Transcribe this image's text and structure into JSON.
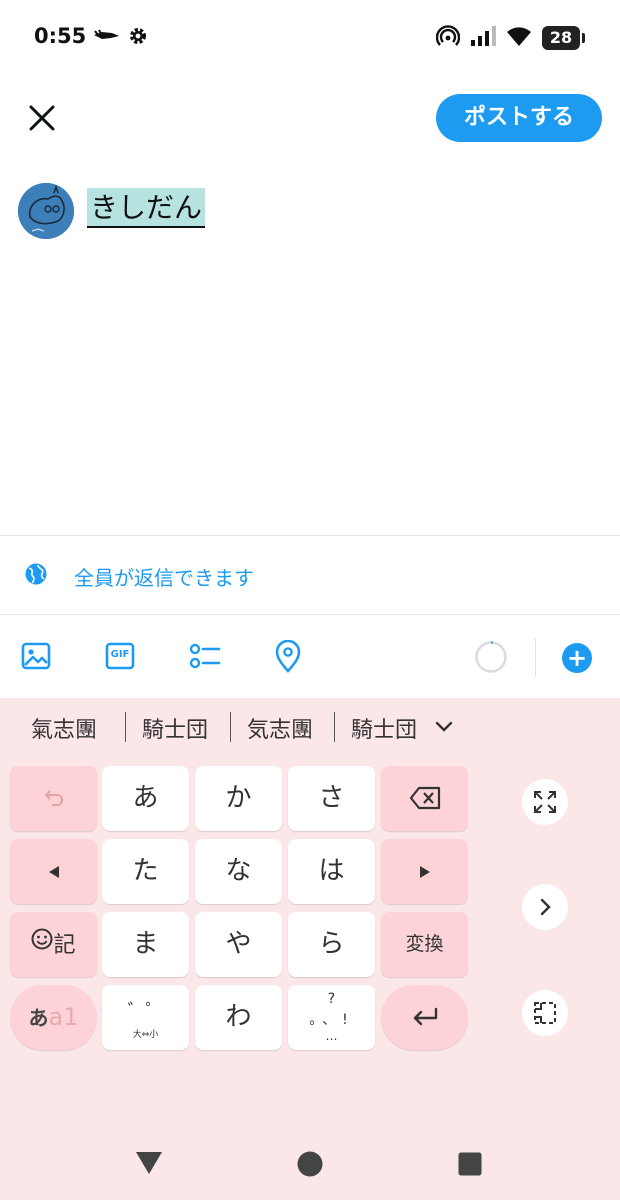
{
  "status_bar": {
    "time": "0:55",
    "battery": "28",
    "icons": [
      "bird-app-icon",
      "gear-icon",
      "hotspot-icon",
      "signal-icon",
      "wifi-icon",
      "battery-icon"
    ]
  },
  "header": {
    "close_icon": "close-icon",
    "post_label": "ポストする"
  },
  "compose": {
    "text": "きしだん",
    "avatar": "avatar"
  },
  "reply_setting": {
    "label": "全員が返信できます",
    "icon": "globe-icon"
  },
  "toolbar": {
    "icons": [
      "image-icon",
      "gif-icon",
      "poll-icon",
      "location-icon"
    ],
    "gif_label": "GIF",
    "add_icon": "+"
  },
  "keyboard": {
    "candidates": [
      "氣志團",
      "騎士団",
      "気志團",
      "騎士団"
    ],
    "keys": {
      "a": "あ",
      "ka": "か",
      "sa": "さ",
      "ta": "た",
      "na": "な",
      "ha": "は",
      "ma": "ま",
      "ya": "や",
      "ra": "ら",
      "wa": "わ",
      "kigou": "記",
      "henkan": "変換",
      "mode_kana": "あ",
      "mode_alpha": "a1",
      "dakuten_marks": "゛゜",
      "dakuten_sub": "大⇔小",
      "punct_top": "?",
      "punct_mid": "。、!",
      "punct_bottom": "…"
    }
  },
  "colors": {
    "accent": "#1d9bf0",
    "keyboard_bg": "#fbe6e8",
    "func_key": "#fdd3d8",
    "highlight": "#b6e2e0"
  }
}
